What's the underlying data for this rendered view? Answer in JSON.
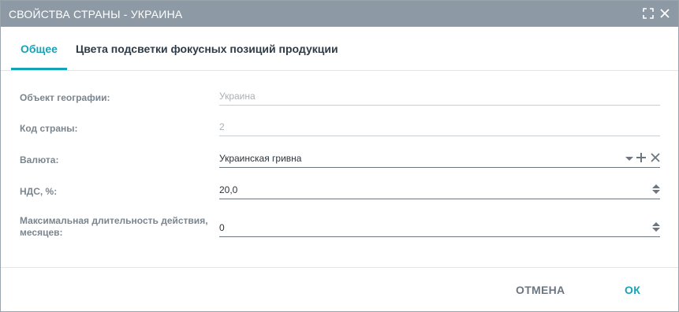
{
  "window": {
    "title": "СВОЙСТВА СТРАНЫ - УКРАИНА"
  },
  "tabs": [
    {
      "label": "Общее",
      "active": true
    },
    {
      "label": "Цвета подсветки фокусных позиций продукции",
      "active": false
    }
  ],
  "form": {
    "geo": {
      "label": "Объект географии:",
      "value": "Украина"
    },
    "code": {
      "label": "Код страны:",
      "value": "2"
    },
    "currency": {
      "label": "Валюта:",
      "value": "Украинская гривна"
    },
    "vat": {
      "label": "НДС, %:",
      "value": "20,0"
    },
    "duration": {
      "label_line1": "Максимальная длительность действия,",
      "label_line2": "месяцев:",
      "value": "0"
    }
  },
  "footer": {
    "cancel_label": "ОТМЕНА",
    "ok_label": "ОК"
  },
  "colors": {
    "titlebar": "#8d9aa5",
    "accent": "#17a2b8",
    "label": "#7b858e"
  },
  "icons": {
    "maximize": "maximize-icon",
    "close": "close-icon",
    "dropdown": "caret-down-icon",
    "add": "plus-icon",
    "clear": "x-icon",
    "spinner": "spinner-arrows-icon"
  }
}
